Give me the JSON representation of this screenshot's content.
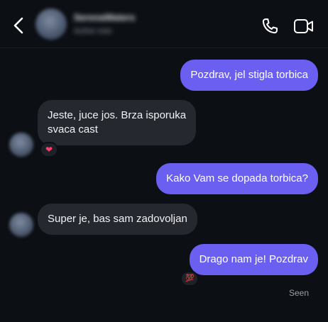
{
  "header": {
    "contact_name": "SerenaWaters",
    "contact_status": "Active now"
  },
  "messages": [
    {
      "direction": "sent",
      "text": "Pozdrav, jel stigla torbica"
    },
    {
      "direction": "received",
      "lines": [
        "Jeste, juce jos. Brza isporuka",
        "svaca cast"
      ],
      "reaction": "❤"
    },
    {
      "direction": "sent",
      "text": "Kako Vam se dopada torbica?"
    },
    {
      "direction": "received",
      "text": "Super je, bas sam zadovoljan"
    },
    {
      "direction": "sent",
      "text": "Drago nam je! Pozdrav",
      "reaction": "💯"
    }
  ],
  "status": {
    "seen_label": "Seen"
  },
  "colors": {
    "background": "#0c0f14",
    "sent_bubble": "#6a5ff0",
    "received_bubble": "#262830",
    "heart_reaction": "#ff3d6e",
    "hundred_reaction": "#e8324a"
  },
  "icons": {
    "back": "chevron-left-icon",
    "call": "phone-icon",
    "video": "video-camera-icon"
  }
}
